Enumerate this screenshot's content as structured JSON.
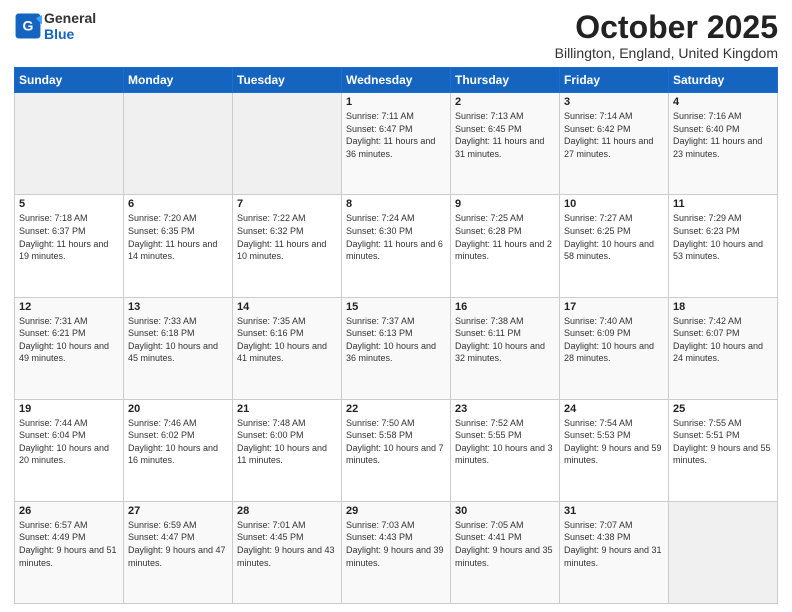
{
  "header": {
    "logo_line1": "General",
    "logo_line2": "Blue",
    "month": "October 2025",
    "location": "Billington, England, United Kingdom"
  },
  "weekdays": [
    "Sunday",
    "Monday",
    "Tuesday",
    "Wednesday",
    "Thursday",
    "Friday",
    "Saturday"
  ],
  "weeks": [
    [
      {
        "day": "",
        "sunrise": "",
        "sunset": "",
        "daylight": "",
        "empty": true
      },
      {
        "day": "",
        "sunrise": "",
        "sunset": "",
        "daylight": "",
        "empty": true
      },
      {
        "day": "",
        "sunrise": "",
        "sunset": "",
        "daylight": "",
        "empty": true
      },
      {
        "day": "1",
        "sunrise": "Sunrise: 7:11 AM",
        "sunset": "Sunset: 6:47 PM",
        "daylight": "Daylight: 11 hours and 36 minutes.",
        "empty": false
      },
      {
        "day": "2",
        "sunrise": "Sunrise: 7:13 AM",
        "sunset": "Sunset: 6:45 PM",
        "daylight": "Daylight: 11 hours and 31 minutes.",
        "empty": false
      },
      {
        "day": "3",
        "sunrise": "Sunrise: 7:14 AM",
        "sunset": "Sunset: 6:42 PM",
        "daylight": "Daylight: 11 hours and 27 minutes.",
        "empty": false
      },
      {
        "day": "4",
        "sunrise": "Sunrise: 7:16 AM",
        "sunset": "Sunset: 6:40 PM",
        "daylight": "Daylight: 11 hours and 23 minutes.",
        "empty": false
      }
    ],
    [
      {
        "day": "5",
        "sunrise": "Sunrise: 7:18 AM",
        "sunset": "Sunset: 6:37 PM",
        "daylight": "Daylight: 11 hours and 19 minutes.",
        "empty": false
      },
      {
        "day": "6",
        "sunrise": "Sunrise: 7:20 AM",
        "sunset": "Sunset: 6:35 PM",
        "daylight": "Daylight: 11 hours and 14 minutes.",
        "empty": false
      },
      {
        "day": "7",
        "sunrise": "Sunrise: 7:22 AM",
        "sunset": "Sunset: 6:32 PM",
        "daylight": "Daylight: 11 hours and 10 minutes.",
        "empty": false
      },
      {
        "day": "8",
        "sunrise": "Sunrise: 7:24 AM",
        "sunset": "Sunset: 6:30 PM",
        "daylight": "Daylight: 11 hours and 6 minutes.",
        "empty": false
      },
      {
        "day": "9",
        "sunrise": "Sunrise: 7:25 AM",
        "sunset": "Sunset: 6:28 PM",
        "daylight": "Daylight: 11 hours and 2 minutes.",
        "empty": false
      },
      {
        "day": "10",
        "sunrise": "Sunrise: 7:27 AM",
        "sunset": "Sunset: 6:25 PM",
        "daylight": "Daylight: 10 hours and 58 minutes.",
        "empty": false
      },
      {
        "day": "11",
        "sunrise": "Sunrise: 7:29 AM",
        "sunset": "Sunset: 6:23 PM",
        "daylight": "Daylight: 10 hours and 53 minutes.",
        "empty": false
      }
    ],
    [
      {
        "day": "12",
        "sunrise": "Sunrise: 7:31 AM",
        "sunset": "Sunset: 6:21 PM",
        "daylight": "Daylight: 10 hours and 49 minutes.",
        "empty": false
      },
      {
        "day": "13",
        "sunrise": "Sunrise: 7:33 AM",
        "sunset": "Sunset: 6:18 PM",
        "daylight": "Daylight: 10 hours and 45 minutes.",
        "empty": false
      },
      {
        "day": "14",
        "sunrise": "Sunrise: 7:35 AM",
        "sunset": "Sunset: 6:16 PM",
        "daylight": "Daylight: 10 hours and 41 minutes.",
        "empty": false
      },
      {
        "day": "15",
        "sunrise": "Sunrise: 7:37 AM",
        "sunset": "Sunset: 6:13 PM",
        "daylight": "Daylight: 10 hours and 36 minutes.",
        "empty": false
      },
      {
        "day": "16",
        "sunrise": "Sunrise: 7:38 AM",
        "sunset": "Sunset: 6:11 PM",
        "daylight": "Daylight: 10 hours and 32 minutes.",
        "empty": false
      },
      {
        "day": "17",
        "sunrise": "Sunrise: 7:40 AM",
        "sunset": "Sunset: 6:09 PM",
        "daylight": "Daylight: 10 hours and 28 minutes.",
        "empty": false
      },
      {
        "day": "18",
        "sunrise": "Sunrise: 7:42 AM",
        "sunset": "Sunset: 6:07 PM",
        "daylight": "Daylight: 10 hours and 24 minutes.",
        "empty": false
      }
    ],
    [
      {
        "day": "19",
        "sunrise": "Sunrise: 7:44 AM",
        "sunset": "Sunset: 6:04 PM",
        "daylight": "Daylight: 10 hours and 20 minutes.",
        "empty": false
      },
      {
        "day": "20",
        "sunrise": "Sunrise: 7:46 AM",
        "sunset": "Sunset: 6:02 PM",
        "daylight": "Daylight: 10 hours and 16 minutes.",
        "empty": false
      },
      {
        "day": "21",
        "sunrise": "Sunrise: 7:48 AM",
        "sunset": "Sunset: 6:00 PM",
        "daylight": "Daylight: 10 hours and 11 minutes.",
        "empty": false
      },
      {
        "day": "22",
        "sunrise": "Sunrise: 7:50 AM",
        "sunset": "Sunset: 5:58 PM",
        "daylight": "Daylight: 10 hours and 7 minutes.",
        "empty": false
      },
      {
        "day": "23",
        "sunrise": "Sunrise: 7:52 AM",
        "sunset": "Sunset: 5:55 PM",
        "daylight": "Daylight: 10 hours and 3 minutes.",
        "empty": false
      },
      {
        "day": "24",
        "sunrise": "Sunrise: 7:54 AM",
        "sunset": "Sunset: 5:53 PM",
        "daylight": "Daylight: 9 hours and 59 minutes.",
        "empty": false
      },
      {
        "day": "25",
        "sunrise": "Sunrise: 7:55 AM",
        "sunset": "Sunset: 5:51 PM",
        "daylight": "Daylight: 9 hours and 55 minutes.",
        "empty": false
      }
    ],
    [
      {
        "day": "26",
        "sunrise": "Sunrise: 6:57 AM",
        "sunset": "Sunset: 4:49 PM",
        "daylight": "Daylight: 9 hours and 51 minutes.",
        "empty": false
      },
      {
        "day": "27",
        "sunrise": "Sunrise: 6:59 AM",
        "sunset": "Sunset: 4:47 PM",
        "daylight": "Daylight: 9 hours and 47 minutes.",
        "empty": false
      },
      {
        "day": "28",
        "sunrise": "Sunrise: 7:01 AM",
        "sunset": "Sunset: 4:45 PM",
        "daylight": "Daylight: 9 hours and 43 minutes.",
        "empty": false
      },
      {
        "day": "29",
        "sunrise": "Sunrise: 7:03 AM",
        "sunset": "Sunset: 4:43 PM",
        "daylight": "Daylight: 9 hours and 39 minutes.",
        "empty": false
      },
      {
        "day": "30",
        "sunrise": "Sunrise: 7:05 AM",
        "sunset": "Sunset: 4:41 PM",
        "daylight": "Daylight: 9 hours and 35 minutes.",
        "empty": false
      },
      {
        "day": "31",
        "sunrise": "Sunrise: 7:07 AM",
        "sunset": "Sunset: 4:38 PM",
        "daylight": "Daylight: 9 hours and 31 minutes.",
        "empty": false
      },
      {
        "day": "",
        "sunrise": "",
        "sunset": "",
        "daylight": "",
        "empty": true
      }
    ]
  ]
}
